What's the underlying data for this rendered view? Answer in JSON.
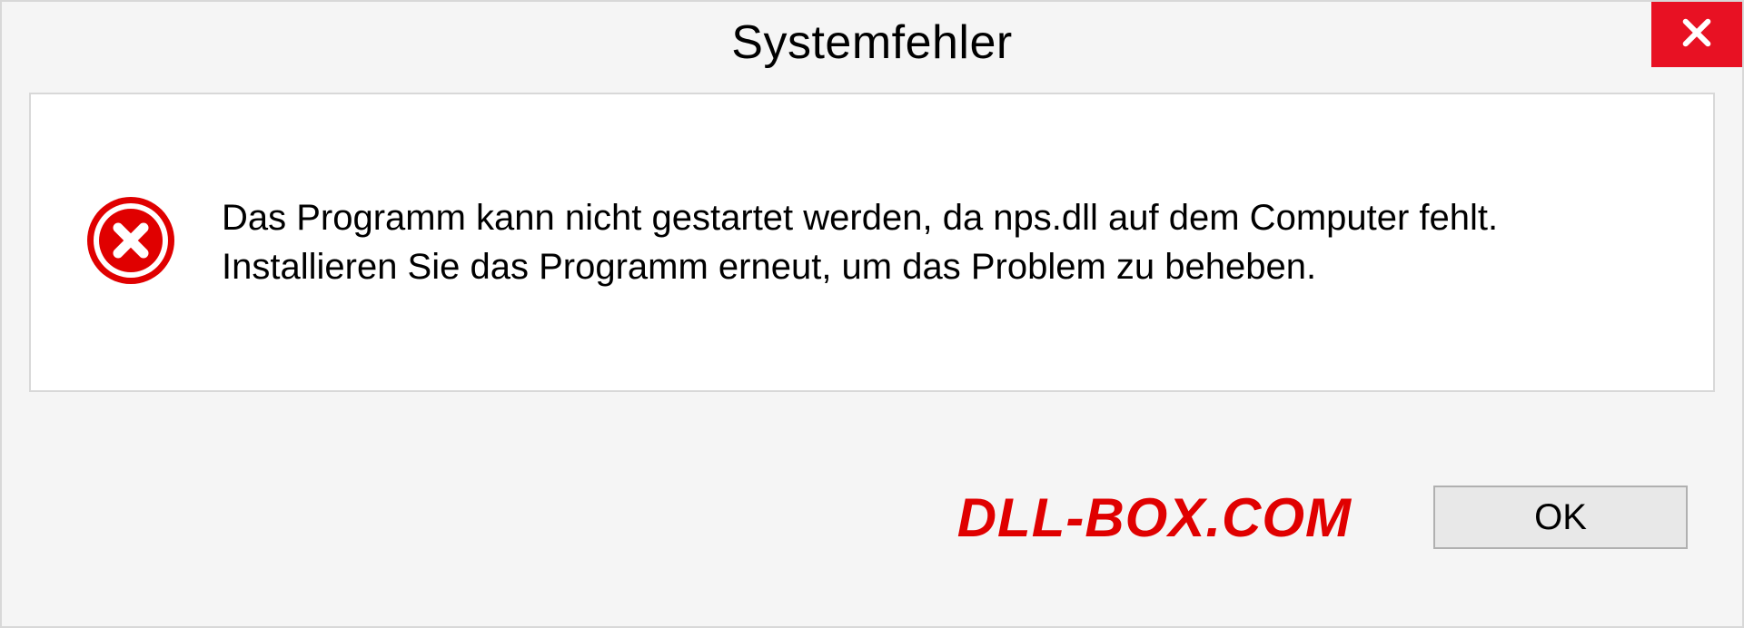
{
  "dialog": {
    "title": "Systemfehler",
    "message": "Das Programm kann nicht gestartet werden, da nps.dll auf dem Computer fehlt. Installieren Sie das Programm erneut, um das Problem zu beheben.",
    "ok_label": "OK",
    "watermark": "DLL-BOX.COM"
  },
  "colors": {
    "close_button_bg": "#e81123",
    "error_icon_fill": "#e00000",
    "watermark_color": "#e00000"
  }
}
